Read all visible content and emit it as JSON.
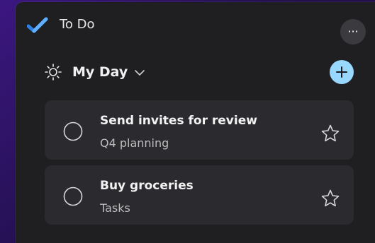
{
  "app": {
    "title": "To Do",
    "logo_icon": "checkmark-logo-icon",
    "more_icon_glyph": "···",
    "accent": "#98d8ff"
  },
  "list": {
    "name": "My Day",
    "icon": "sun-icon",
    "add_icon": "plus-icon"
  },
  "tasks": [
    {
      "title": "Send invites for review",
      "list": "Q4 planning",
      "completed": false,
      "starred": false
    },
    {
      "title": "Buy groceries",
      "list": "Tasks",
      "completed": false,
      "starred": false
    }
  ]
}
